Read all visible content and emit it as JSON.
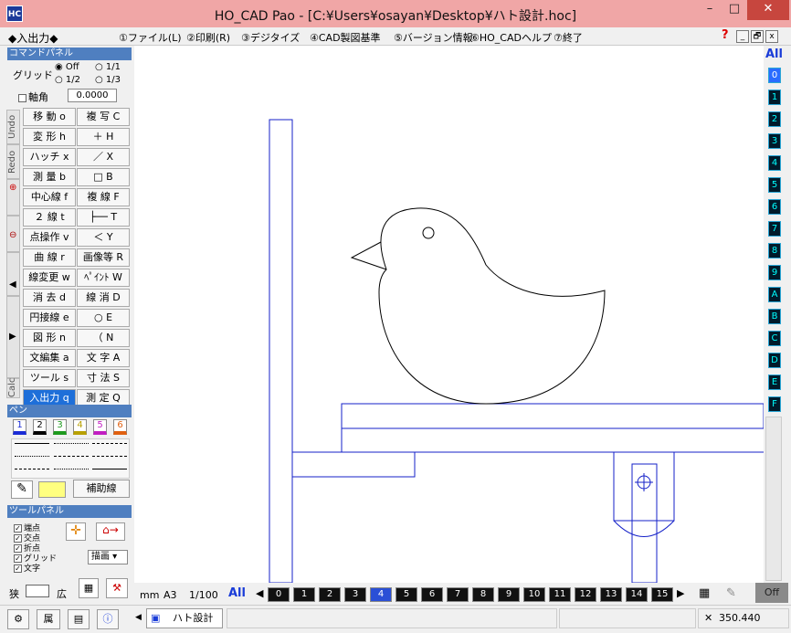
{
  "window": {
    "title": "HO_CAD Pao - [C:¥Users¥osayan¥Desktop¥ハト設計.hoc]",
    "app_icon_text": "HC",
    "minimize": "–",
    "maximize": "□",
    "close": "✕"
  },
  "menu": {
    "mode": "◆入出力◆",
    "items": [
      "①ファイル(L)",
      "②印刷(R)",
      "③デジタイズ",
      "④CAD製図基準",
      "⑤バージョン情報",
      "⑥HO_CADヘルプ",
      "⑦終了"
    ],
    "help": "?",
    "mdi_buttons": [
      "_",
      "🗗",
      "x"
    ]
  },
  "command_panel": {
    "title": "コマンドパネル",
    "grid_label": "グリッド",
    "grid_options": [
      "Off",
      "1/1",
      "1/2",
      "1/3"
    ],
    "axis_label": "軸角",
    "axis_value": "0.0000",
    "buttons_left": [
      "移 動 o",
      "変 形 h",
      "ハッチ x",
      "測 量 b",
      "中心線 f",
      "２ 線 t",
      "点操作 v",
      "曲 線 r",
      "線変更 w",
      "消 去 d",
      "円接線 e",
      "図 形 n",
      "文編集 a",
      "ツール s",
      "入出力 q"
    ],
    "buttons_right": [
      "複 写 C",
      "＋ H",
      "／ X",
      "□ B",
      "複 線 F",
      "├── T",
      "＜ Y",
      "画像等 R",
      "ﾍﾟｲﾝﾄ W",
      "線 消 D",
      "○ E",
      "（ N",
      "文 字 A",
      "寸 法 S",
      "測 定 Q"
    ],
    "side_tabs": [
      "Undo",
      "Redo",
      "Calc"
    ]
  },
  "pen_panel": {
    "title": "ペン",
    "colors": [
      "1",
      "2",
      "3",
      "4",
      "5",
      "6"
    ],
    "color_hex": [
      "#1a2bd6",
      "#000000",
      "#1e9a1e",
      "#b8a000",
      "#c21ec2",
      "#e06010"
    ],
    "aux_line_label": "補助線"
  },
  "tool_panel": {
    "title": "ツールパネル",
    "snaps": [
      "端点",
      "交点",
      "折点",
      "グリッド",
      "文字"
    ],
    "draw_select": "描画",
    "narrow_label": "狭",
    "wide_label": "広"
  },
  "status": {
    "unit": "mm",
    "paper": "A3",
    "scale": "1/100",
    "all_label": "All",
    "layers": [
      "0",
      "1",
      "2",
      "3",
      "4",
      "5",
      "6",
      "7",
      "8",
      "9",
      "10",
      "11",
      "12",
      "13",
      "14",
      "15"
    ],
    "selected_layer": "4",
    "off_label": "Off"
  },
  "layer_column": {
    "all_label": "All",
    "layers": [
      "0",
      "1",
      "2",
      "3",
      "4",
      "5",
      "6",
      "7",
      "8",
      "9",
      "A",
      "B",
      "C",
      "D",
      "E",
      "F"
    ]
  },
  "bottom": {
    "tab_label": "ハト設計",
    "coordinate": "350.440",
    "attr_label": "属"
  }
}
